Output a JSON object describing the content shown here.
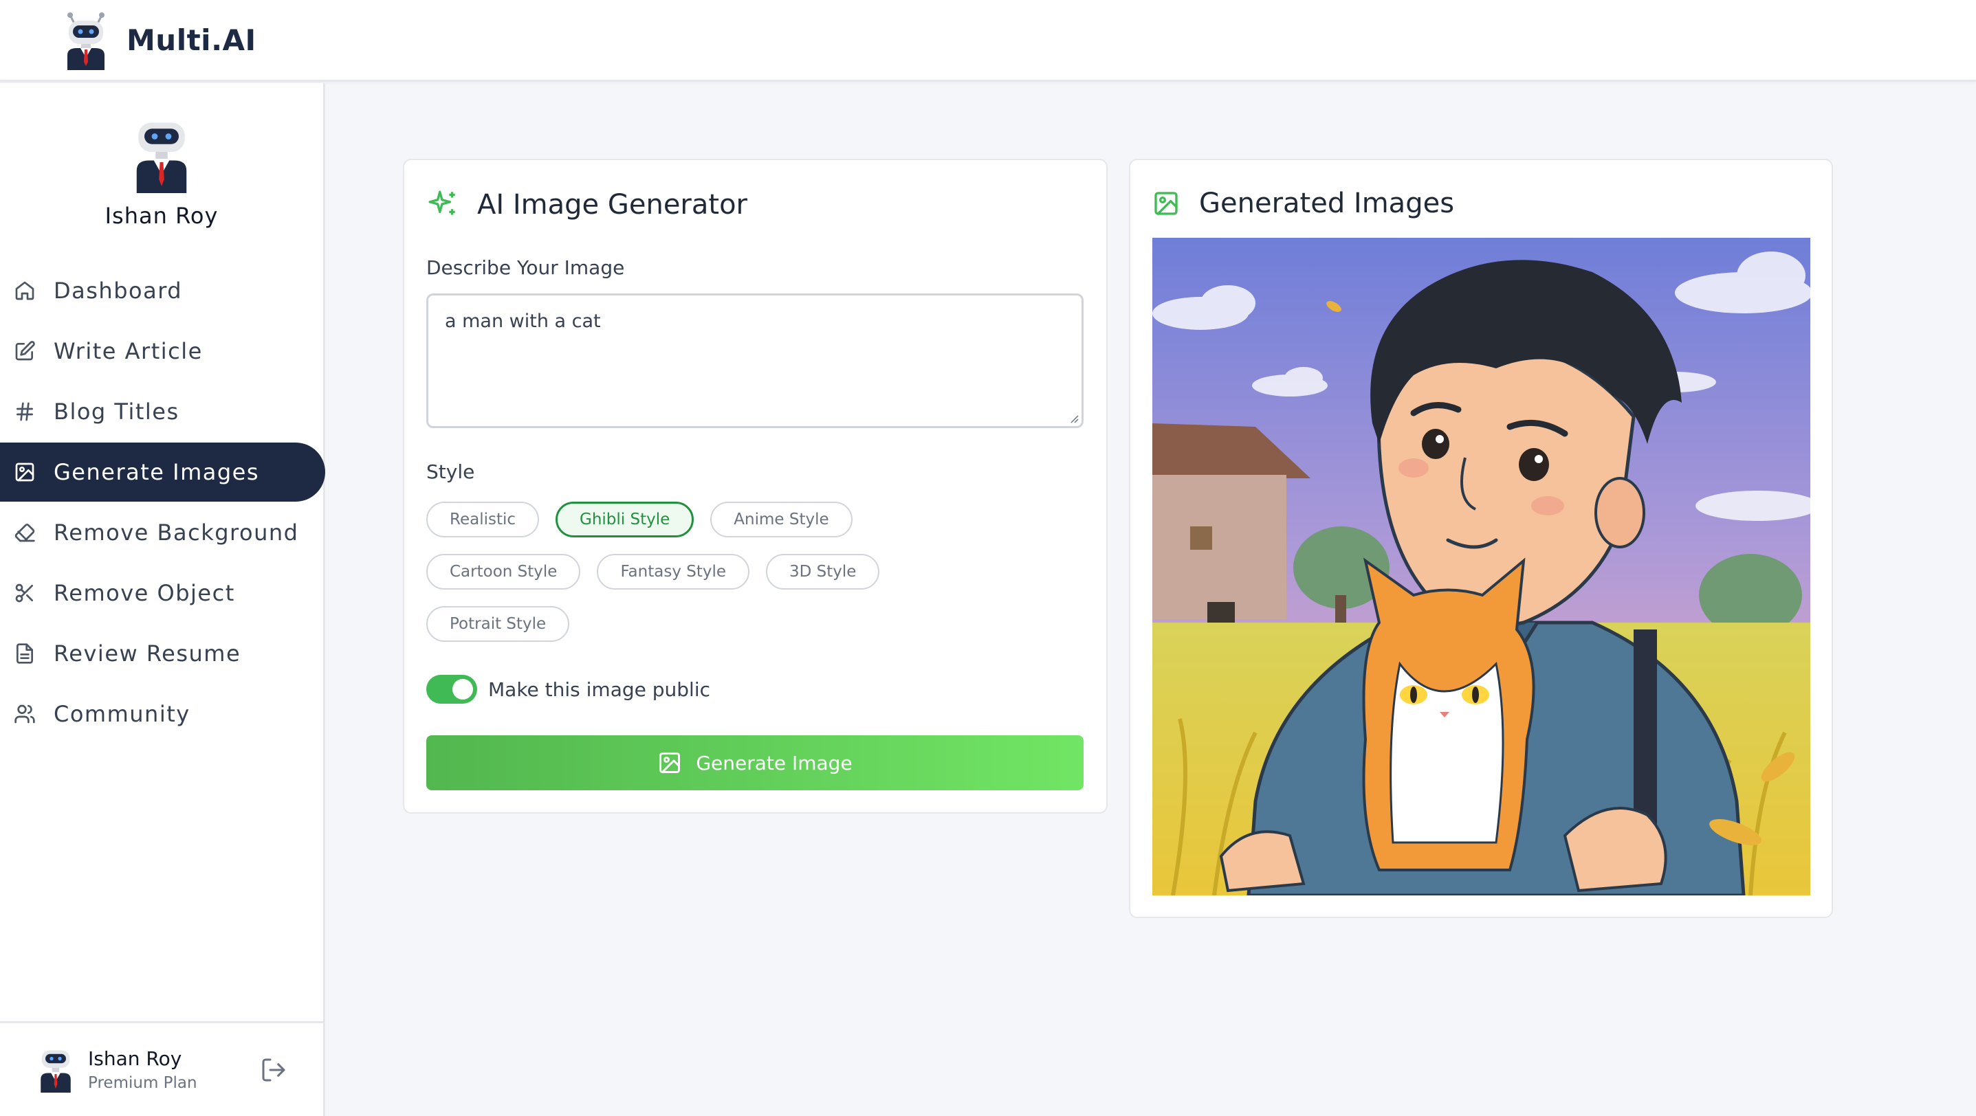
{
  "app": {
    "name": "Multi.AI"
  },
  "sidebar": {
    "user_name": "Ishan Roy",
    "items": [
      {
        "label": "Dashboard",
        "icon": "home-icon"
      },
      {
        "label": "Write Article",
        "icon": "edit-icon"
      },
      {
        "label": "Blog Titles",
        "icon": "hash-icon"
      },
      {
        "label": "Generate Images",
        "icon": "image-icon",
        "active": true
      },
      {
        "label": "Remove Background",
        "icon": "eraser-icon"
      },
      {
        "label": "Remove Object",
        "icon": "scissors-icon"
      },
      {
        "label": "Review Resume",
        "icon": "file-text-icon"
      },
      {
        "label": "Community",
        "icon": "users-icon"
      }
    ],
    "footer": {
      "name": "Ishan Roy",
      "plan": "Premium Plan"
    }
  },
  "generator": {
    "title": "AI Image Generator",
    "prompt_label": "Describe Your Image",
    "prompt_value": "a man with a cat",
    "style_label": "Style",
    "styles": [
      "Realistic",
      "Ghibli Style",
      "Anime Style",
      "Cartoon Style",
      "Fantasy Style",
      "3D Style",
      "Potrait Style"
    ],
    "selected_style": "Ghibli Style",
    "public_label": "Make this image public",
    "public_enabled": true,
    "button_label": "Generate Image"
  },
  "results": {
    "title": "Generated Images"
  },
  "colors": {
    "accent_green": "#22913f",
    "button_gradient_start": "#52b74f",
    "button_gradient_end": "#71e564",
    "sidebar_active": "#1e2a44"
  }
}
